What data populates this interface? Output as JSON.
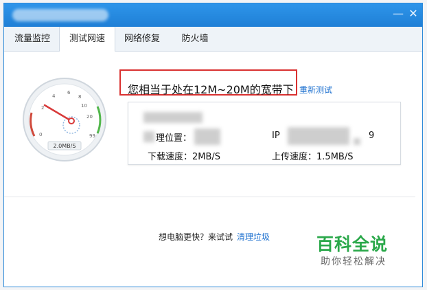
{
  "tabs": [
    {
      "label": "流量监控",
      "active": false
    },
    {
      "label": "测试网速",
      "active": true
    },
    {
      "label": "网络修复",
      "active": false
    },
    {
      "label": "防火墙",
      "active": false
    }
  ],
  "window_buttons": {
    "minimize": "—",
    "close": "✕"
  },
  "gauge": {
    "ticks": [
      "0",
      "2",
      "4",
      "6",
      "8",
      "10",
      "20",
      "99"
    ],
    "speed_label": "2.0MB/S"
  },
  "result": {
    "headline": "您相当于处在12M~20M的宽带下",
    "retest_link": "重新测试"
  },
  "details": {
    "location_label": "理位置：",
    "ip_label": "IP",
    "ip_suffix": "9",
    "download_label": "下载速度：",
    "download_value": "2MB/S",
    "upload_label": "上传速度：",
    "upload_value": "1.5MB/S"
  },
  "promo": {
    "text": "想电脑更快？来试试",
    "link": "清理垃圾"
  },
  "watermark": {
    "title": "百科全说",
    "subtitle": "助你轻松解决"
  },
  "colors": {
    "accent": "#1f7fd6",
    "highlight_border": "#d9302f",
    "link": "#1b6fcf",
    "watermark_green": "#2aa84a"
  }
}
